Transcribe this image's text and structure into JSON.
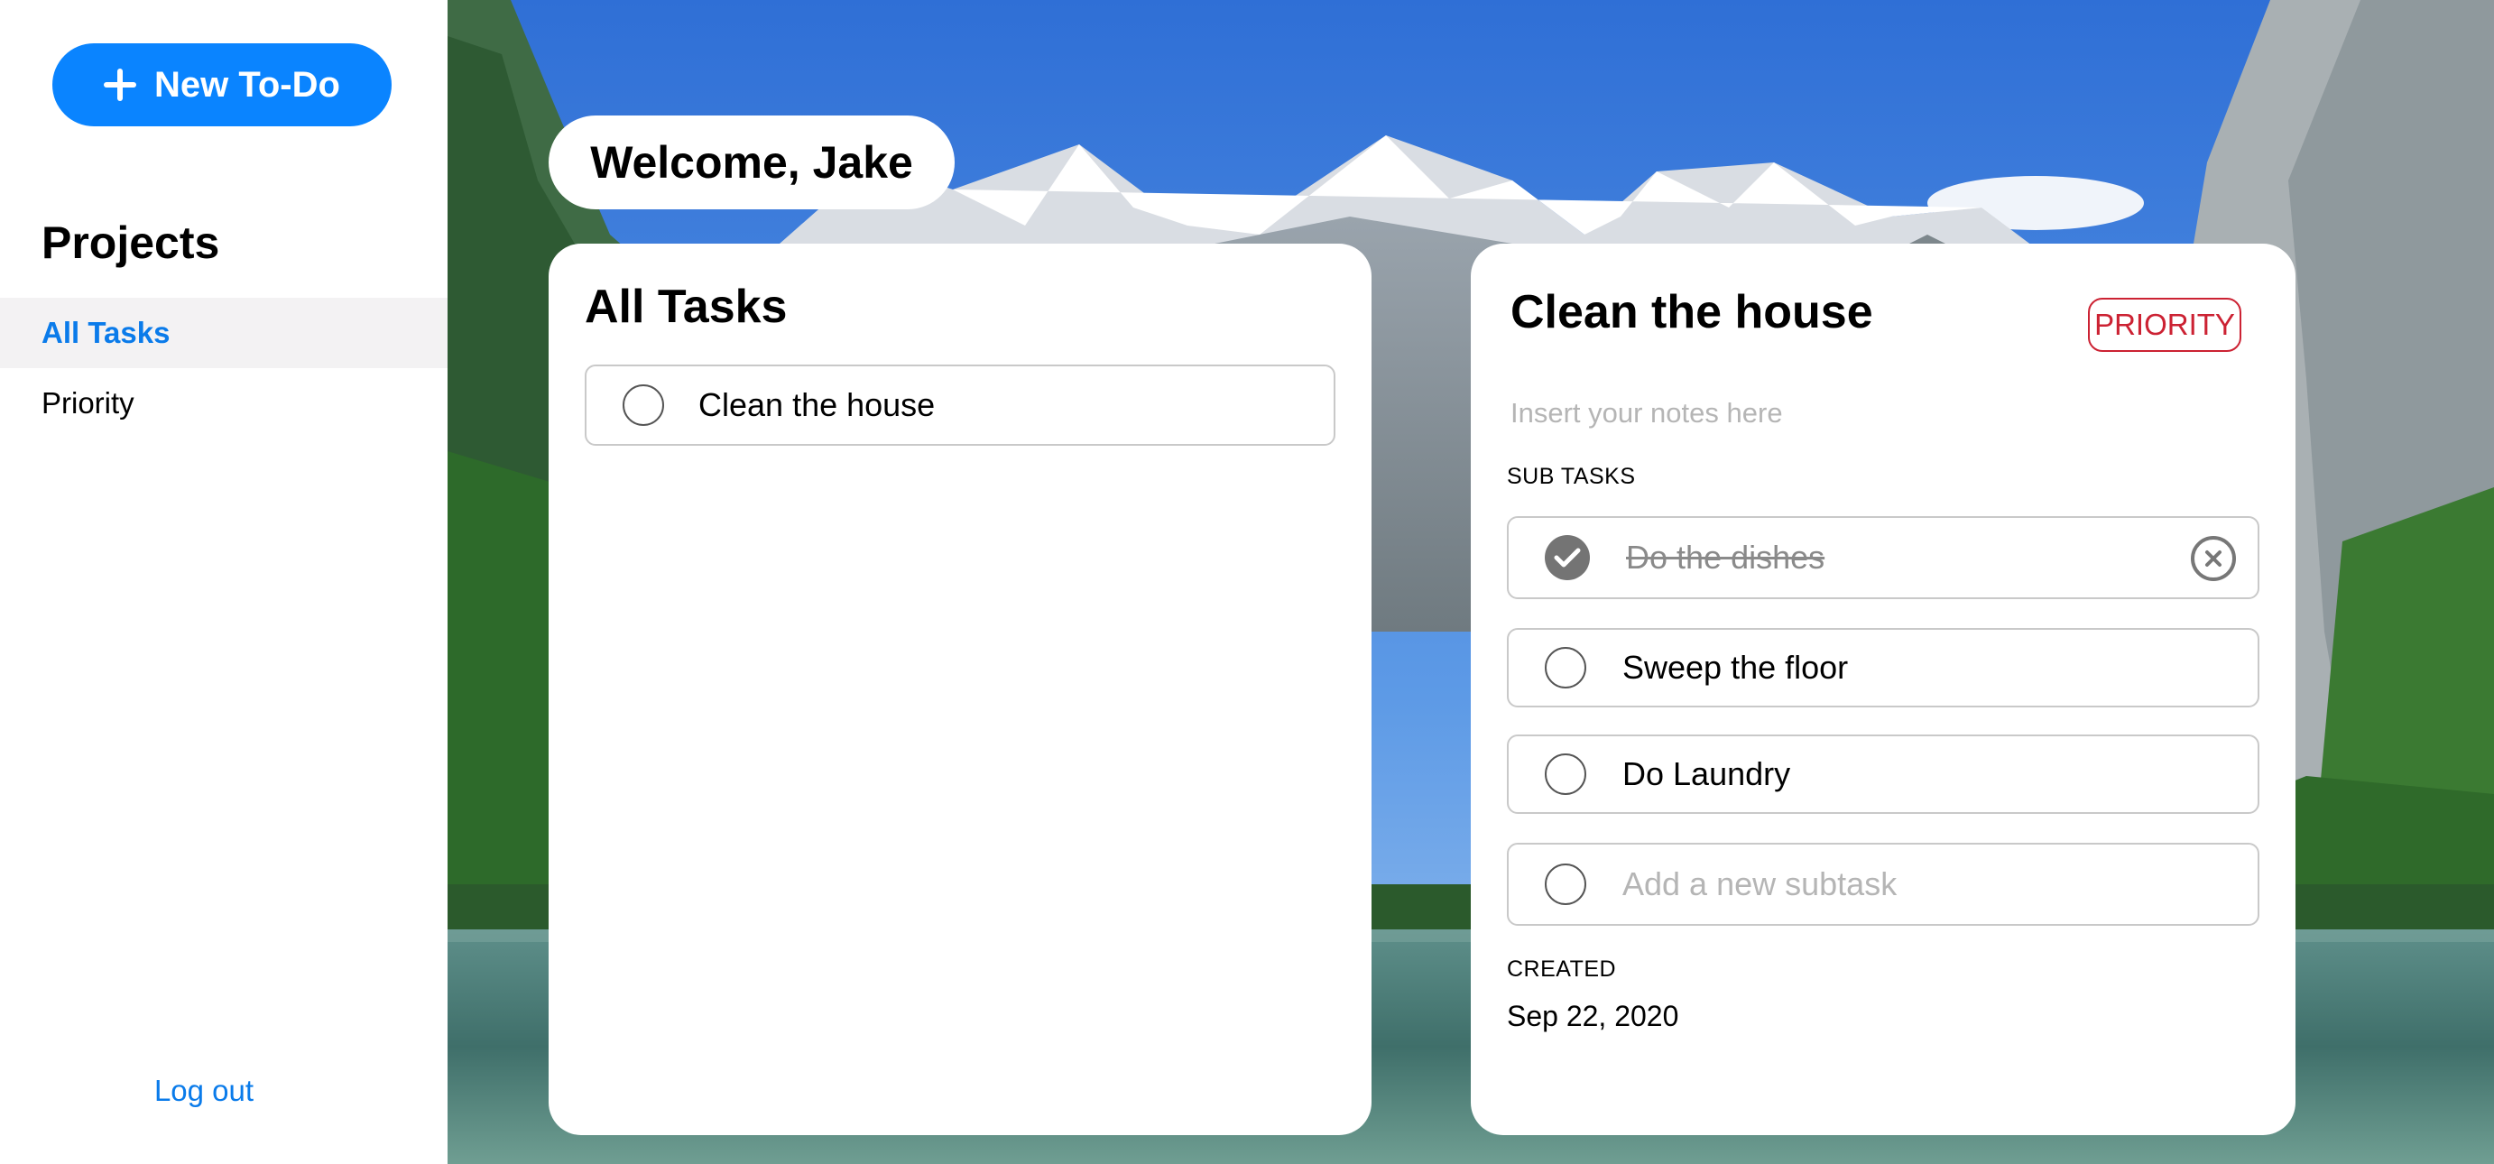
{
  "sidebar": {
    "new_todo_label": "New To-Do",
    "projects_heading": "Projects",
    "items": [
      {
        "label": "All Tasks",
        "active": true
      },
      {
        "label": "Priority",
        "active": false
      }
    ],
    "logout_label": "Log out"
  },
  "header": {
    "welcome": "Welcome, Jake"
  },
  "tasks_panel": {
    "title": "All Tasks",
    "tasks": [
      {
        "label": "Clean the house",
        "done": false
      }
    ]
  },
  "detail_panel": {
    "title": "Clean the house",
    "priority_badge": "PRIORITY",
    "notes_placeholder": "Insert your notes here",
    "subtasks_label": "SUB TASKS",
    "subtasks": [
      {
        "label": "Do the dishes",
        "done": true
      },
      {
        "label": "Sweep the floor",
        "done": false
      },
      {
        "label": "Do Laundry",
        "done": false
      }
    ],
    "new_subtask_placeholder": "Add a new subtask",
    "created_label": "CREATED",
    "created_date": "Sep 22, 2020"
  },
  "colors": {
    "accent": "#0a84ff",
    "link": "#0a7bea",
    "priority": "#cc2233",
    "active_nav_bg": "#f3f2f3"
  },
  "icons": [
    "plus-icon",
    "circle-checkbox-icon",
    "checkmark-icon",
    "remove-x-icon"
  ]
}
